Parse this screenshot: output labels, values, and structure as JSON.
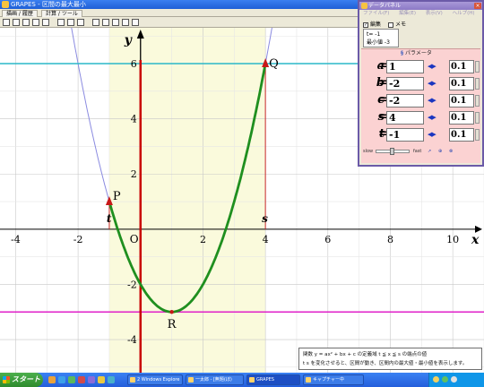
{
  "main_window": {
    "title": "GRAPES - 区間の最大最小",
    "tabs": [
      "描画 / 履歴",
      "計算 / ツール"
    ]
  },
  "graph": {
    "x_label": "x",
    "y_label": "y",
    "origin_label": "O",
    "x_ticks": [
      "-4",
      "-2",
      "2",
      "4",
      "6",
      "8",
      "10"
    ],
    "y_ticks": [
      "6",
      "4",
      "2",
      "-2",
      "-4"
    ],
    "point_labels": [
      "P",
      "Q",
      "R"
    ],
    "t_label": "t",
    "s_label": "s",
    "colors": {
      "curve": "#1f8f1f",
      "full_parabola": "#8a8ae0",
      "max_line": "#2ab8c8",
      "min_line": "#e020c8",
      "interval_fill": "#fafadc",
      "x_eq_zero_line": "#c80000"
    }
  },
  "chart_data": {
    "type": "line",
    "function": "y = x^2 - 2x - 2",
    "parameters": {
      "a": 1,
      "b": -2,
      "c": -2,
      "s": 4,
      "t": -1
    },
    "xlim": [
      -4.5,
      11
    ],
    "ylim": [
      -5.2,
      7.3
    ],
    "curve_domain": [
      -1,
      4
    ],
    "points": {
      "P": [
        -1,
        1
      ],
      "Q": [
        4,
        6
      ],
      "R": [
        1,
        -3
      ]
    },
    "max_value": 6,
    "min_value": -3
  },
  "data_panel": {
    "title": "データパネル",
    "menu": [
      "ファイル(F)",
      "編集(E)",
      "表示(V)",
      "ヘルプ(H)"
    ],
    "checkbox_edit": "編集",
    "checkbox_memo": "メモ",
    "status_line1": "t= -1",
    "status_line2": "最小値 -3",
    "params_header": "パラメータ",
    "params": [
      {
        "name": "a",
        "value": "1",
        "step": "0.1"
      },
      {
        "name": "b",
        "value": "-2",
        "step": "0.1"
      },
      {
        "name": "c",
        "value": "-2",
        "step": "0.1"
      },
      {
        "name": "s",
        "value": "4",
        "step": "0.1"
      },
      {
        "name": "t",
        "value": "-1",
        "step": "0.1"
      }
    ],
    "speed_slow": "slow",
    "speed_fast": "fast"
  },
  "description": {
    "line1": "関数 y = ax² + bx + c の定義域 t ≦ x ≦ s の端点の値",
    "line2": "t  s  を変化させると、区間が動き、区間内の最大値・最小値を表示します。"
  },
  "taskbar": {
    "start_label": "スタート",
    "tasks": [
      "2 Windows Explore",
      "一太郎 - [無題(ぼ)",
      "GRAPES",
      "キャプチャー中"
    ]
  }
}
